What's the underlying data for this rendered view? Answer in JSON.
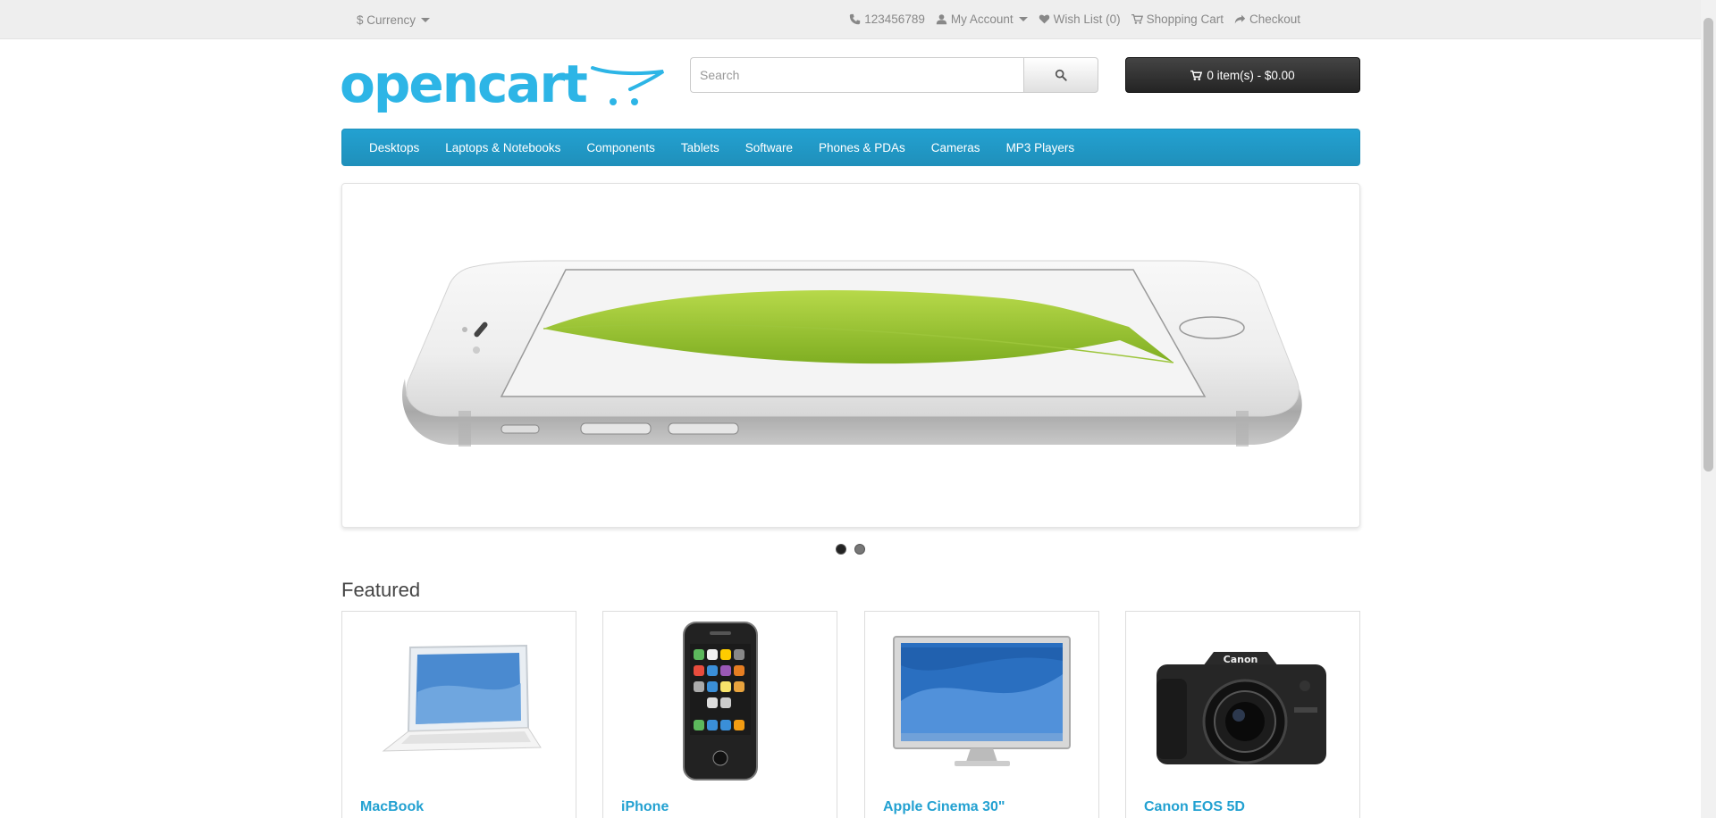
{
  "topbar": {
    "currency_label": "$ Currency",
    "phone": "123456789",
    "my_account": "My Account",
    "wish_list": "Wish List (0)",
    "shopping_cart": "Shopping Cart",
    "checkout": "Checkout"
  },
  "logo": {
    "text": "opencart",
    "color": "#2db5e6"
  },
  "search": {
    "placeholder": "Search"
  },
  "cart": {
    "label": "0 item(s) - $0.00"
  },
  "menu": {
    "items": [
      {
        "label": "Desktops"
      },
      {
        "label": "Laptops & Notebooks"
      },
      {
        "label": "Components"
      },
      {
        "label": "Tablets"
      },
      {
        "label": "Software"
      },
      {
        "label": "Phones & PDAs"
      },
      {
        "label": "Cameras"
      },
      {
        "label": "MP3 Players"
      }
    ]
  },
  "slideshow": {
    "slide_count": 2,
    "active_slide": 1
  },
  "featured": {
    "title": "Featured",
    "products": [
      {
        "name": "MacBook",
        "icon": "laptop"
      },
      {
        "name": "iPhone",
        "icon": "phone"
      },
      {
        "name": "Apple Cinema 30\"",
        "icon": "monitor"
      },
      {
        "name": "Canon EOS 5D",
        "icon": "camera"
      }
    ]
  },
  "colors": {
    "accent": "#23a1d1",
    "cart_bg": "#303030",
    "topbar_bg": "#eeeeee"
  }
}
